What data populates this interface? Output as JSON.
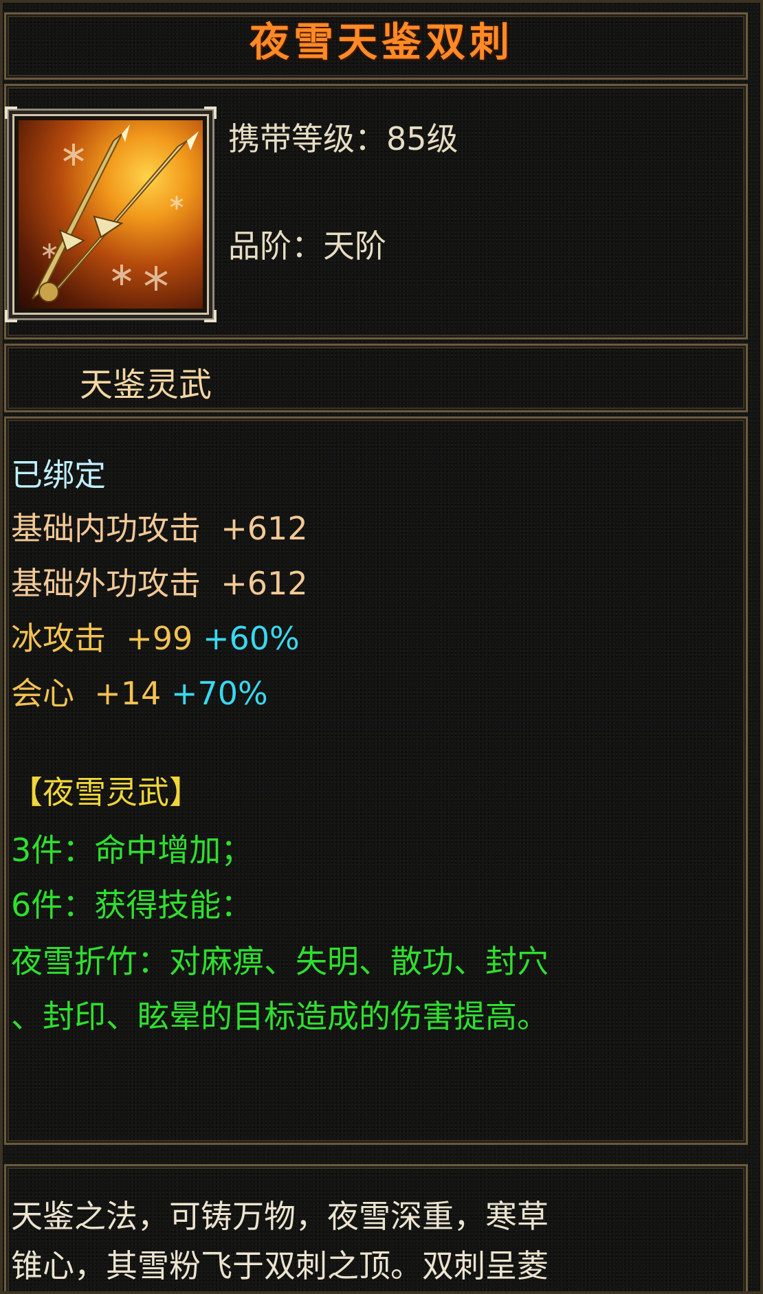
{
  "item": {
    "name": "夜雪天鉴双刺",
    "icon": "twin-daggers-snowflake-icon",
    "carry_level": "携带等级：85级",
    "grade": "品阶：天阶",
    "series": "天鉴灵武"
  },
  "stats": {
    "bound": "已绑定",
    "lines": [
      {
        "label": "基础内功攻击",
        "value": "+612"
      },
      {
        "label": "基础外功攻击",
        "value": "+612"
      },
      {
        "label": "冰攻击",
        "value": "+99",
        "bonus": "+60%"
      },
      {
        "label": "会心",
        "value": "+14",
        "bonus": "+70%"
      }
    ]
  },
  "set": {
    "title": "【夜雪灵武】",
    "piece3": "3件：命中增加；",
    "piece6": "6件：获得技能：",
    "skill_line1": "夜雪折竹：对麻痹、失明、散功、封穴",
    "skill_line2": "、封印、眩晕的目标造成的伤害提高。"
  },
  "description": {
    "line1": "天鉴之法，可铸万物，夜雪深重，寒草",
    "line2": "锥心，其雪粉飞于双刺之顶。双刺呈菱"
  },
  "colors": {
    "title": "#ff8a26",
    "bound": "#bfefff",
    "base_stat": "#f3c996",
    "element_stat": "#f3c251",
    "percent_bonus": "#38d9f0",
    "set_title": "#f1d63a",
    "set_effect": "#2ee02e",
    "border": "#6b5a3e"
  }
}
